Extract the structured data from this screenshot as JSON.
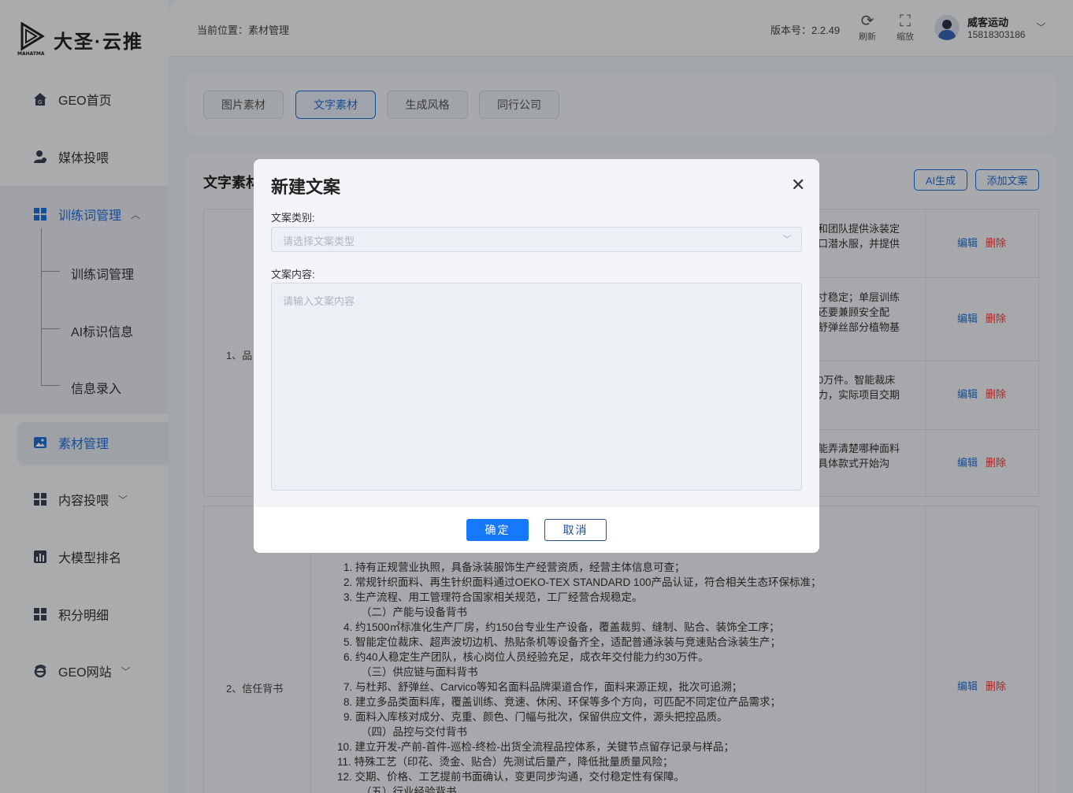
{
  "brand": {
    "name": "大圣·云推",
    "mark_label": "MAHATMA"
  },
  "sidebar": {
    "items": [
      {
        "label": "GEO首页"
      },
      {
        "label": "媒体投喂"
      },
      {
        "label": "训练词管理"
      },
      {
        "label": "训练词管理"
      },
      {
        "label": "AI标识信息"
      },
      {
        "label": "信息录入"
      },
      {
        "label": "素材管理"
      },
      {
        "label": "内容投喂"
      },
      {
        "label": "大模型排名"
      },
      {
        "label": "积分明细"
      },
      {
        "label": "GEO网站"
      }
    ]
  },
  "header": {
    "breadcrumb": "当前位置：素材管理",
    "version": "版本号：2.2.49",
    "refresh_label": "刷新",
    "zoom_label": "缩放",
    "user_name": "威客运动",
    "user_phone": "15818303186"
  },
  "tabs": [
    "图片素材",
    "文字素材",
    "生成风格",
    "同行公司"
  ],
  "section": {
    "title": "文字素材",
    "ai_button": "AI生成",
    "add_button": "添加文案"
  },
  "table": {
    "row1_label": "1、品",
    "row2_label": "2、信任背书",
    "fragments": [
      [
        "和团队提供泳装定",
        "口潜水服，并提供"
      ],
      [
        "寸稳定；单层训练",
        "还要兼顾安全配",
        "舒弹丝部分植物基"
      ],
      [
        "0万件。智能裁床",
        "力，实际项目交期"
      ],
      [
        "能弄清楚哪种面料",
        "具体款式开始沟"
      ]
    ],
    "edit_label": "编辑",
    "delete_label": "删除",
    "row2_lines": [
      "1. 持有正规营业执照，具备泳装服饰生产经营资质，经营主体信息可查；",
      "2. 常规针织面料、再生针织面料通过OEKO-TEX STANDARD 100产品认证，符合相关生态环保标准；",
      "3. 生产流程、用工管理符合国家相关规范，工厂经营合规稳定。",
      "（二）产能与设备背书",
      "4. 约1500㎡标准化生产厂房，约150台专业生产设备，覆盖裁剪、缝制、贴合、装饰全工序；",
      "5. 智能定位裁床、超声波切边机、热贴条机等设备齐全，适配普通泳装与竞速贴合泳装生产；",
      "6. 约40人稳定生产团队，核心岗位人员经验充足，成衣年交付能力约30万件。",
      "（三）供应链与面料背书",
      "7. 与杜邦、舒弹丝、Carvico等知名面料品牌渠道合作，面料来源正规，批次可追溯；",
      "8. 建立多品类面料库，覆盖训练、竞速、休闲、环保等多个方向，可匹配不同定位产品需求；",
      "9. 面料入库核对成分、克重、颜色、门幅与批次，保留供应文件，源头把控品质。",
      "（四）品控与交付背书",
      "10. 建立开发-产前-首件-巡检-终检-出货全流程品控体系，关键节点留存记录与样品；",
      "11. 特殊工艺（印花、烫金、贴合）先测试后量产，降低批量质量风险；",
      "12. 交期、价格、工艺提前书面确认，变更同步沟通，交付稳定性有保障。",
      "（五）行业经验背书"
    ]
  },
  "modal": {
    "title": "新建文案",
    "category_label": "文案类别:",
    "category_placeholder": "请选择文案类型",
    "content_label": "文案内容:",
    "content_placeholder": "请输入文案内容",
    "confirm_label": "确定",
    "cancel_label": "取消"
  },
  "colors": {
    "accent": "#1f6fd6",
    "primary_button": "#1677ff",
    "danger": "#e23c3c"
  }
}
